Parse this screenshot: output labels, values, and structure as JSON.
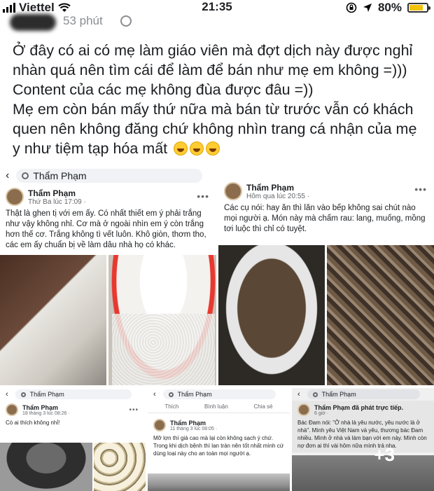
{
  "status_bar": {
    "carrier": "Viettel",
    "time": "21:35",
    "battery": "80%",
    "battery_level": 0.8
  },
  "post": {
    "time": "53 phút",
    "lines": [
      "Ở đây có ai có mẹ làm giáo viên mà đợt dịch này được nghỉ",
      "nhàn quá  nên tìm cái để làm để bán như mẹ em không =)))",
      "Content của các mẹ không đùa được đâu =))",
      "Mẹ em còn bán mấy thứ nữa mà bán từ trước vẫn có khách",
      "quen nên không đăng chứ không nhìn trang cá nhận của mẹ",
      "y như tiệm tạp hóa mất"
    ]
  },
  "shots": {
    "s1": {
      "search": "Thẩm Phạm",
      "name": "Thẩm Phạm",
      "meta": "Thứ Ba lúc 17:09 · ",
      "body": "Thật là ghen tị với em ấy. Có nhất thiết em ý phải trắng như vậy không nhỉ. Cơ mà ở ngoài nhìn em ý còn trắng hơn thế cơ. Trắng không tì vết luôn. Khô giòn, thơm tho, các em ấy chuẩn bị về làm dâu nhà họ có khác."
    },
    "s2": {
      "name": "Thẩm Phạm",
      "meta": "Hôm qua lúc 20:55 · ",
      "body": "Các cụ nói: hay ăn thì lăn vào bếp không sai chút nào mọi người ạ. Món này mà chấm rau: lang, muống, mồng tơi luộc thì chỉ có tuyệt."
    },
    "s3": {
      "search": "Thẩm Phạm",
      "name": "Thẩm Phạm",
      "meta": "18 tháng 3 lúc 08:26 · ",
      "body": "Có ai thích không nhỉ!"
    },
    "s4": {
      "search": "Thẩm Phạm",
      "actions": [
        "Thích",
        "Bình luận",
        "Chia sẻ"
      ],
      "name": "Thẩm Phạm",
      "meta": "11 tháng 3 lúc 08:05 · ",
      "body": "Mỡ lợn thì giá cao mà lại còn không sạch ý chứ. Trong khi dịch bệnh thì lan tràn nên tốt nhất mình cứ dùng loại này cho an toàn mọi người ạ."
    },
    "s5": {
      "search": "Thẩm Phạm",
      "name": "Thẩm Phạm đã phát trực tiếp.",
      "meta": "6 giờ · ",
      "body": "Bác Đam nói: \"Ở nhà là yêu nước, yêu nước là ở nhà\". Mình yêu Việt Nam và yêu, thương bác Đam nhiều. Mình ở nhà và làm bạn với em này. Mình còn nợ đơn ai thì vài hôm nữa mình trả nha.",
      "more": "+3"
    }
  }
}
